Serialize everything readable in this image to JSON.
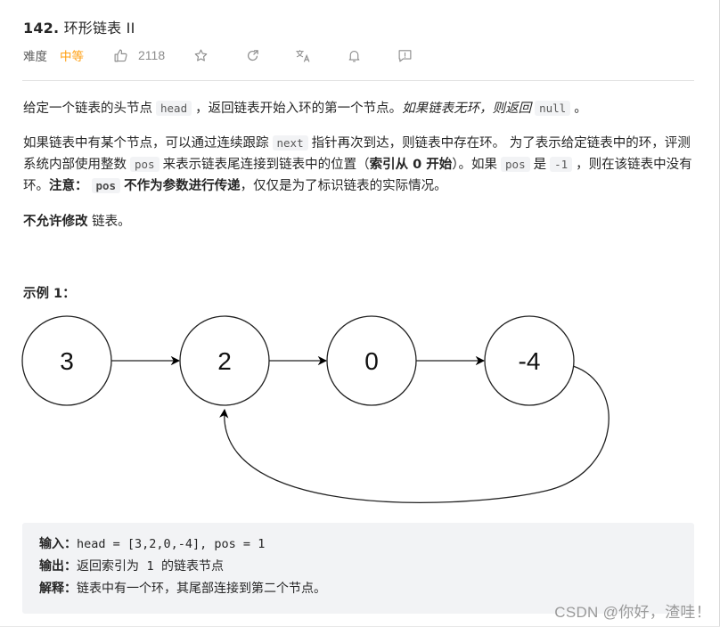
{
  "problem": {
    "number": "142.",
    "title": "环形链表 II",
    "difficulty_label": "难度",
    "difficulty": "中等",
    "likes": "2118",
    "accent_color": "#ffa116"
  },
  "toolbar_icons": [
    "thumbs-up-icon",
    "star-icon",
    "share-icon",
    "translate-icon",
    "bell-icon",
    "feedback-icon"
  ],
  "description": {
    "p1": {
      "t1": "给定一个链表的头节点",
      "c1": "head",
      "t2": "，返回链表开始入环的第一个节点。",
      "t3_italic": "如果链表无环，则返回",
      "c2": "null",
      "t4": "。"
    },
    "p2": {
      "t1": "如果链表中有某个节点，可以通过连续跟踪",
      "c1": "next",
      "t2": "指针再次到达，则链表中存在环。 为了表示给定链表中的环，评测系统内部使用整数",
      "c2": "pos",
      "t3": "来表示链表尾连接到链表中的位置（",
      "b1": "索引从 0 开始",
      "t4": "）。如果",
      "c3": "pos",
      "t5": "是",
      "c4": "-1",
      "t6": "，则在该链表中没有环。",
      "b2": "注意：",
      "c5": "pos",
      "b3": "不作为参数进行传递",
      "t7": "，仅仅是为了标识链表的实际情况。"
    },
    "p3": {
      "b1": "不允许修改",
      "t1": "链表。"
    }
  },
  "example": {
    "label": "示例 1：",
    "diagram": {
      "nodes": [
        "3",
        "2",
        "0",
        "-4"
      ],
      "edges": [
        [
          0,
          1
        ],
        [
          1,
          2
        ],
        [
          2,
          3
        ],
        [
          3,
          1
        ]
      ]
    },
    "input_label": "输入：",
    "input_value": "head = [3,2,0,-4], pos = 1",
    "output_label": "输出：",
    "output_text_1": "返回索引为",
    "output_code": "1",
    "output_text_2": "的链表节点",
    "explain_label": "解释：",
    "explain_text": "链表中有一个环，其尾部连接到第二个节点。"
  },
  "watermark": "CSDN @你好，渣哇！"
}
